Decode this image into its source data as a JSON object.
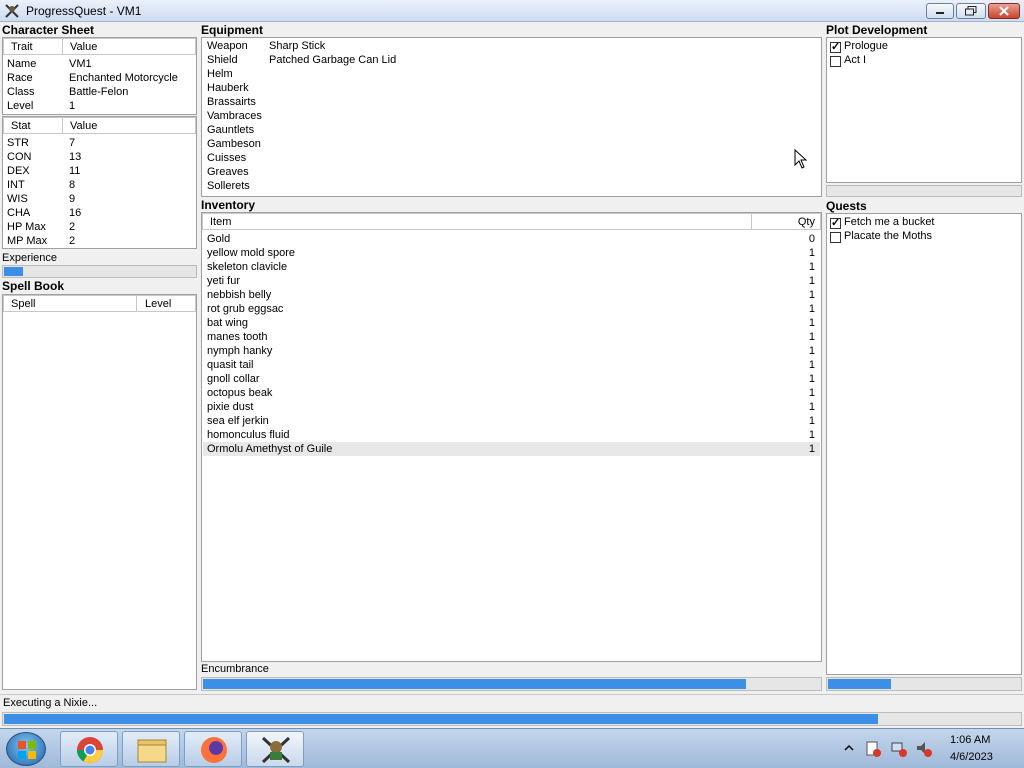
{
  "window": {
    "title": "ProgressQuest - VM1"
  },
  "character_sheet": {
    "title": "Character Sheet",
    "trait_header": "Trait",
    "value_header": "Value",
    "traits": [
      {
        "k": "Name",
        "v": "VM1"
      },
      {
        "k": "Race",
        "v": "Enchanted Motorcycle"
      },
      {
        "k": "Class",
        "v": "Battle-Felon"
      },
      {
        "k": "Level",
        "v": "1"
      }
    ],
    "stat_header": "Stat",
    "stat_value_header": "Value",
    "stats": [
      {
        "k": "STR",
        "v": "7"
      },
      {
        "k": "CON",
        "v": "13"
      },
      {
        "k": "DEX",
        "v": "11"
      },
      {
        "k": "INT",
        "v": "8"
      },
      {
        "k": "WIS",
        "v": "9"
      },
      {
        "k": "CHA",
        "v": "16"
      },
      {
        "k": "HP Max",
        "v": "2"
      },
      {
        "k": "MP Max",
        "v": "2"
      }
    ],
    "experience_label": "Experience",
    "experience_progress": 0.1
  },
  "spell_book": {
    "title": "Spell Book",
    "spell_header": "Spell",
    "level_header": "Level"
  },
  "equipment": {
    "title": "Equipment",
    "slots": [
      {
        "slot": "Weapon",
        "item": "Sharp Stick"
      },
      {
        "slot": "Shield",
        "item": "Patched Garbage Can Lid"
      },
      {
        "slot": "Helm",
        "item": ""
      },
      {
        "slot": "Hauberk",
        "item": ""
      },
      {
        "slot": "Brassairts",
        "item": ""
      },
      {
        "slot": "Vambraces",
        "item": ""
      },
      {
        "slot": "Gauntlets",
        "item": ""
      },
      {
        "slot": "Gambeson",
        "item": ""
      },
      {
        "slot": "Cuisses",
        "item": ""
      },
      {
        "slot": "Greaves",
        "item": ""
      },
      {
        "slot": "Sollerets",
        "item": ""
      }
    ]
  },
  "inventory": {
    "title": "Inventory",
    "item_header": "Item",
    "qty_header": "Qty",
    "items": [
      {
        "name": "Gold",
        "qty": "0"
      },
      {
        "name": "yellow mold spore",
        "qty": "1"
      },
      {
        "name": "skeleton clavicle",
        "qty": "1"
      },
      {
        "name": "yeti fur",
        "qty": "1"
      },
      {
        "name": "nebbish belly",
        "qty": "1"
      },
      {
        "name": "rot grub eggsac",
        "qty": "1"
      },
      {
        "name": "bat wing",
        "qty": "1"
      },
      {
        "name": "manes tooth",
        "qty": "1"
      },
      {
        "name": "nymph hanky",
        "qty": "1"
      },
      {
        "name": "quasit tail",
        "qty": "1"
      },
      {
        "name": "gnoll collar",
        "qty": "1"
      },
      {
        "name": "octopus beak",
        "qty": "1"
      },
      {
        "name": "pixie dust",
        "qty": "1"
      },
      {
        "name": "sea elf jerkin",
        "qty": "1"
      },
      {
        "name": "homonculus fluid",
        "qty": "1"
      },
      {
        "name": "Ormolu Amethyst of Guile",
        "qty": "1"
      }
    ],
    "encumbrance_label": "Encumbrance",
    "encumbrance_progress": 0.88
  },
  "plot": {
    "title": "Plot Development",
    "acts": [
      {
        "label": "Prologue",
        "checked": true
      },
      {
        "label": "Act I",
        "checked": false
      }
    ]
  },
  "quests": {
    "title": "Quests",
    "items": [
      {
        "label": "Fetch me a bucket",
        "checked": true
      },
      {
        "label": "Placate the Moths",
        "checked": false
      }
    ],
    "progress": 0.33
  },
  "status": {
    "text": "Executing a Nixie...",
    "progress": 0.86
  },
  "taskbar": {
    "time": "1:06 AM",
    "date": "4/6/2023"
  },
  "colors": {
    "progress_fill": "#3c8ee6",
    "selection": "#e8e8e8"
  }
}
